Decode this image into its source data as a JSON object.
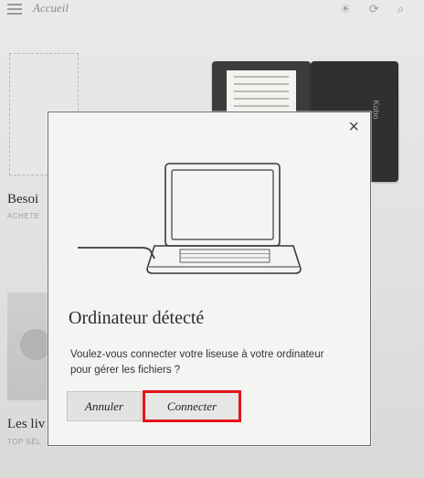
{
  "topbar": {
    "title": "Accueil",
    "icons": [
      "menu-icon",
      "light-icon",
      "sync-icon",
      "search-icon"
    ]
  },
  "background": {
    "section1_title": "Besoi",
    "section1_subtitle": "ACHETE",
    "section2_title": "Les liv",
    "section2_subtitle": "TOP SÉL",
    "device_brand": "Kobo"
  },
  "dialog": {
    "title": "Ordinateur détecté",
    "message": "Voulez-vous connecter votre liseuse à votre ordinateur pour gérer les fichiers ?",
    "cancel_label": "Annuler",
    "connect_label": "Connecter",
    "close_glyph": "×",
    "highlight_color": "#e1121b"
  }
}
